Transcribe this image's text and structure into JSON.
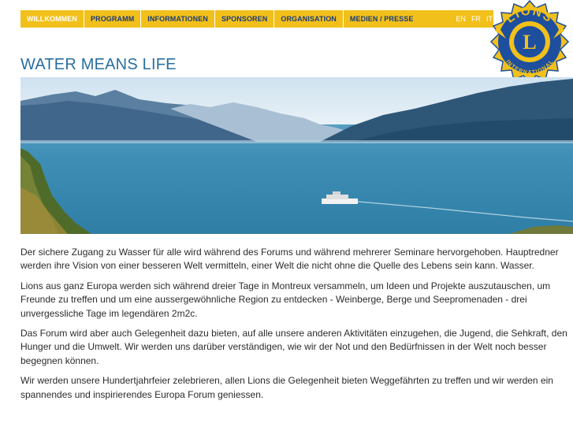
{
  "nav": {
    "items": [
      {
        "label": "WILLKOMMEN",
        "active": true
      },
      {
        "label": "PROGRAMM",
        "active": false
      },
      {
        "label": "INFORMATIONEN",
        "active": false
      },
      {
        "label": "SPONSOREN",
        "active": false
      },
      {
        "label": "ORGANISATION",
        "active": false
      },
      {
        "label": "MEDIEN / PRESSE",
        "active": false
      }
    ],
    "languages": [
      "EN",
      "FR",
      "IT"
    ]
  },
  "logo": {
    "icon": "lions-international-logo",
    "text_top": "LIONS",
    "letter": "L",
    "text_bottom": "INTERNATIONAL"
  },
  "page": {
    "title": "WATER MEANS LIFE",
    "paragraphs": [
      "Der sichere Zugang zu Wasser für alle wird während des Forums und während mehrerer Seminare hervorgehoben. Hauptredner werden ihre Vision von einer besseren Welt vermitteln, einer Welt die nicht ohne die Quelle des Lebens sein kann. Wasser.",
      "Lions aus ganz Europa werden sich während dreier Tage in Montreux versammeln, um Ideen und Projekte auszutauschen, um Freunde zu treffen und um eine aussergewöhnliche Region zu entdecken - Weinberge, Berge und Seepromenaden - drei unvergessliche Tage im legendären 2m2c.",
      "Das Forum wird aber auch Gelegenheit dazu bieten, auf alle unsere anderen Aktivitäten einzugehen, die Jugend, die Sehkraft, den Hunger und die Umwelt. Wir werden uns darüber verständigen, wie wir der Not und den Bedürfnissen in der Welt noch besser begegnen können.",
      "Wir werden unsere Hundertjahrfeier zelebrieren, allen Lions die Gelegenheit bieten Weggefährten zu treffen und wir werden ein spannendes und inspirierendes Europa Forum geniessen."
    ]
  },
  "colors": {
    "nav_bg": "#f2c01b",
    "nav_text": "#1a3a7a",
    "title": "#2a6ea0",
    "logo_blue": "#1d4f9e",
    "logo_gold": "#f2c01b"
  }
}
